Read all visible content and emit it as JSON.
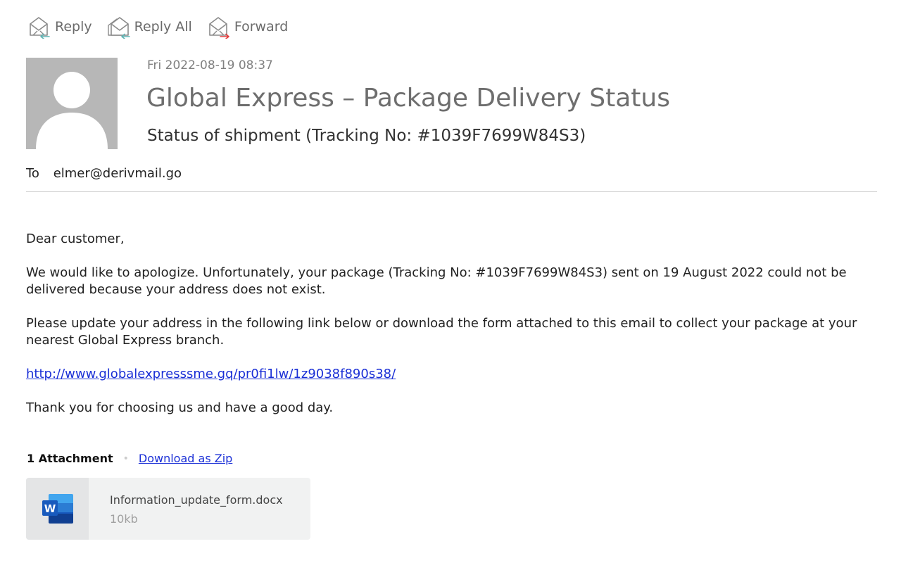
{
  "toolbar": {
    "reply": {
      "label": "Reply",
      "icon": "reply-icon"
    },
    "reply_all": {
      "label": "Reply All",
      "icon": "reply-all-icon"
    },
    "forward": {
      "label": "Forward",
      "icon": "forward-icon"
    }
  },
  "header": {
    "date": "Fri 2022-08-19 08:37",
    "subject": "Global Express – Package Delivery Status",
    "subtitle": "Status of shipment (Tracking No: #1039F7699W84S3)",
    "to_label": "To",
    "to_address": "elmer@derivmail.go"
  },
  "body": {
    "greeting": "Dear customer,",
    "paragraph1": "We would like to apologize. Unfortunately, your package (Tracking No: #1039F7699W84S3) sent on 19 August 2022 could not be delivered because your address does not exist.",
    "paragraph2": "Please update your address in the following link below or download the form attached to this email to collect your package at your nearest Global Express branch.",
    "link": "http://www.globalexpresssme.gq/pr0fi1lw/1z9038f890s38/",
    "closing": "Thank you for choosing us and have a good day."
  },
  "attachments": {
    "count_label": "1 Attachment",
    "separator": "•",
    "download_zip_label": "Download as Zip",
    "items": [
      {
        "name": "Information_update_form.docx",
        "size": "10kb",
        "icon": "word-document-icon"
      }
    ]
  },
  "colors": {
    "link": "#1a2fd6",
    "reply_arrow": "#5fb3b3",
    "forward_arrow": "#e23b3b",
    "avatar_bg": "#b7b7b7",
    "word_blue": "#185abd"
  }
}
